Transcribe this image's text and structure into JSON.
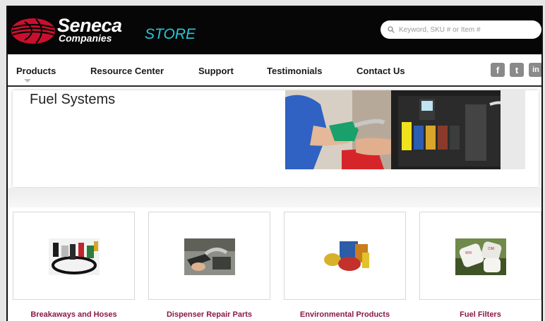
{
  "header": {
    "brand_name": "Seneca",
    "brand_sub": "Companies",
    "store_label": "STORE",
    "search_placeholder": "Keyword, SKU # or Item #"
  },
  "nav": {
    "items": [
      {
        "label": "Products"
      },
      {
        "label": "Resource Center"
      },
      {
        "label": "Support"
      },
      {
        "label": "Testimonials"
      },
      {
        "label": "Contact Us"
      }
    ],
    "social": [
      {
        "glyph": "f",
        "icon": "facebook-icon"
      },
      {
        "glyph": "t",
        "icon": "twitter-icon"
      },
      {
        "glyph": "in",
        "icon": "linkedin-icon"
      }
    ]
  },
  "hero": {
    "title": "Fuel Systems"
  },
  "categories": [
    {
      "label": "Breakaways and Hoses"
    },
    {
      "label": "Dispenser Repair Parts"
    },
    {
      "label": "Environmental Products"
    },
    {
      "label": "Fuel Filters"
    }
  ],
  "colors": {
    "header_bg": "#060606",
    "store_accent": "#27c6d6",
    "category_link": "#8b1748",
    "logo_red": "#c8102e"
  }
}
